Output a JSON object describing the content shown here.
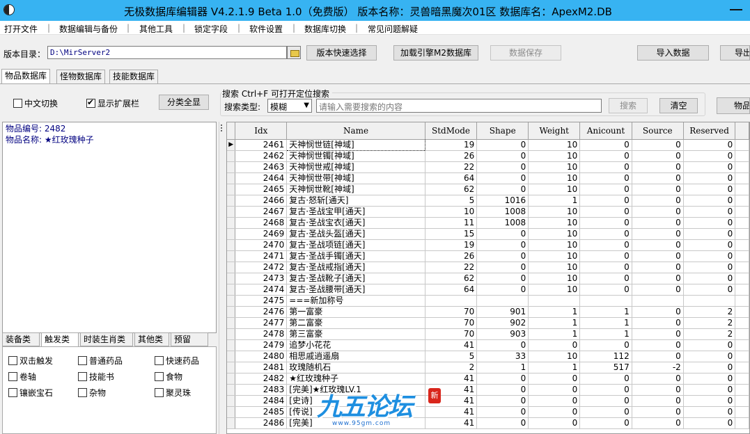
{
  "window": {
    "title": "无极数据库编辑器 V4.2.1.9    Beta 1.0（免费版）    版本名称：灵兽暗黑魔次01区     数据库名：ApexM2.DB"
  },
  "menu": [
    "打开文件",
    "数据编辑与备份",
    "其他工具",
    "锁定字段",
    "软件设置",
    "数据库切换",
    "常见问题解疑"
  ],
  "toolbar": {
    "dir_label": "版本目录：",
    "dir_value": "D:\\MirServer2",
    "quick_select": "版本快速选择",
    "load_engine": "加载引擎M2数据库",
    "save_data": "数据保存",
    "import_data": "导入数据",
    "export_data": "导出"
  },
  "main_tabs": [
    "物品数据库",
    "怪物数据库",
    "技能数据库"
  ],
  "options": {
    "chinese_toggle": "中文切换",
    "show_ext": "显示扩展栏",
    "show_ext_checked": true,
    "show_all": "分类全显"
  },
  "search": {
    "title": "搜索   Ctrl+F 可打开定位搜索",
    "type_label": "搜索类型:",
    "type_value": "模糊",
    "placeholder": "请输入需要搜索的内容",
    "search_btn": "搜索",
    "clear_btn": "清空",
    "item_btn": "物品"
  },
  "info": {
    "item_no": "物品编号: 2482",
    "item_name": "物品名称: ★红玫瑰种子"
  },
  "category_tabs": [
    "装备类",
    "触发类",
    "时装生肖类",
    "其他类",
    "预留"
  ],
  "category_active": 1,
  "categories": [
    [
      "双击触发",
      "普通药品",
      "快速药品"
    ],
    [
      "卷轴",
      "技能书",
      "食物"
    ],
    [
      "镶嵌宝石",
      "杂物",
      "聚灵珠"
    ]
  ],
  "grid": {
    "columns": [
      "Idx",
      "Name",
      "StdMode",
      "Shape",
      "Weight",
      "Anicount",
      "Source",
      "Reserved"
    ],
    "rows": [
      [
        "2461",
        "天神悯世链[神域]",
        "19",
        "0",
        "10",
        "0",
        "0",
        "0"
      ],
      [
        "2462",
        "天神悯世镯[神域]",
        "26",
        "0",
        "10",
        "0",
        "0",
        "0"
      ],
      [
        "2463",
        "天神悯世戒[神域]",
        "22",
        "0",
        "10",
        "0",
        "0",
        "0"
      ],
      [
        "2464",
        "天神悯世带[神域]",
        "64",
        "0",
        "10",
        "0",
        "0",
        "0"
      ],
      [
        "2465",
        "天神悯世靴[神域]",
        "62",
        "0",
        "10",
        "0",
        "0",
        "0"
      ],
      [
        "2466",
        "复古·怒斩[通天]",
        "5",
        "1016",
        "1",
        "0",
        "0",
        "0"
      ],
      [
        "2467",
        "复古·圣战宝甲[通天]",
        "10",
        "1008",
        "10",
        "0",
        "0",
        "0"
      ],
      [
        "2468",
        "复古·圣战宝衣[通天]",
        "11",
        "1008",
        "10",
        "0",
        "0",
        "0"
      ],
      [
        "2469",
        "复古·圣战头盔[通天]",
        "15",
        "0",
        "10",
        "0",
        "0",
        "0"
      ],
      [
        "2470",
        "复古·圣战项链[通天]",
        "19",
        "0",
        "10",
        "0",
        "0",
        "0"
      ],
      [
        "2471",
        "复古·圣战手镯[通天]",
        "26",
        "0",
        "10",
        "0",
        "0",
        "0"
      ],
      [
        "2472",
        "复古·圣战戒指[通天]",
        "22",
        "0",
        "10",
        "0",
        "0",
        "0"
      ],
      [
        "2473",
        "复古·圣战靴子[通天]",
        "62",
        "0",
        "10",
        "0",
        "0",
        "0"
      ],
      [
        "2474",
        "复古·圣战腰带[通天]",
        "64",
        "0",
        "10",
        "0",
        "0",
        "0"
      ],
      [
        "2475",
        "===新加称号",
        "",
        "",
        "",
        "",
        "",
        ""
      ],
      [
        "2476",
        "第一富豪",
        "70",
        "901",
        "1",
        "1",
        "0",
        "2"
      ],
      [
        "2477",
        "第二富豪",
        "70",
        "902",
        "1",
        "1",
        "0",
        "2"
      ],
      [
        "2478",
        "第三富豪",
        "70",
        "903",
        "1",
        "1",
        "0",
        "2"
      ],
      [
        "2479",
        "追梦小花花",
        "41",
        "0",
        "0",
        "0",
        "0",
        "0"
      ],
      [
        "2480",
        "相思戚逍遥扇",
        "5",
        "33",
        "10",
        "112",
        "0",
        "0"
      ],
      [
        "2481",
        "玫瑰随机石",
        "2",
        "1",
        "1",
        "517",
        "-2",
        "0"
      ],
      [
        "2482",
        "★红玫瑰种子",
        "41",
        "0",
        "0",
        "0",
        "0",
        "0"
      ],
      [
        "2483",
        "[完美]★红玫瑰LV.1",
        "41",
        "0",
        "0",
        "0",
        "0",
        "0"
      ],
      [
        "2484",
        "[史诗]",
        "41",
        "0",
        "0",
        "0",
        "0",
        "0"
      ],
      [
        "2485",
        "[传说]",
        "41",
        "0",
        "0",
        "0",
        "0",
        "0"
      ],
      [
        "2486",
        "[完美]",
        "41",
        "0",
        "0",
        "0",
        "0",
        "0"
      ]
    ],
    "current_row_marker": "▶"
  },
  "watermark": {
    "text": "九五论坛",
    "badge": "新",
    "url": "www.95gm.com"
  },
  "colors": {
    "titlebar": "#37b3f2",
    "info_text": "#000080"
  }
}
